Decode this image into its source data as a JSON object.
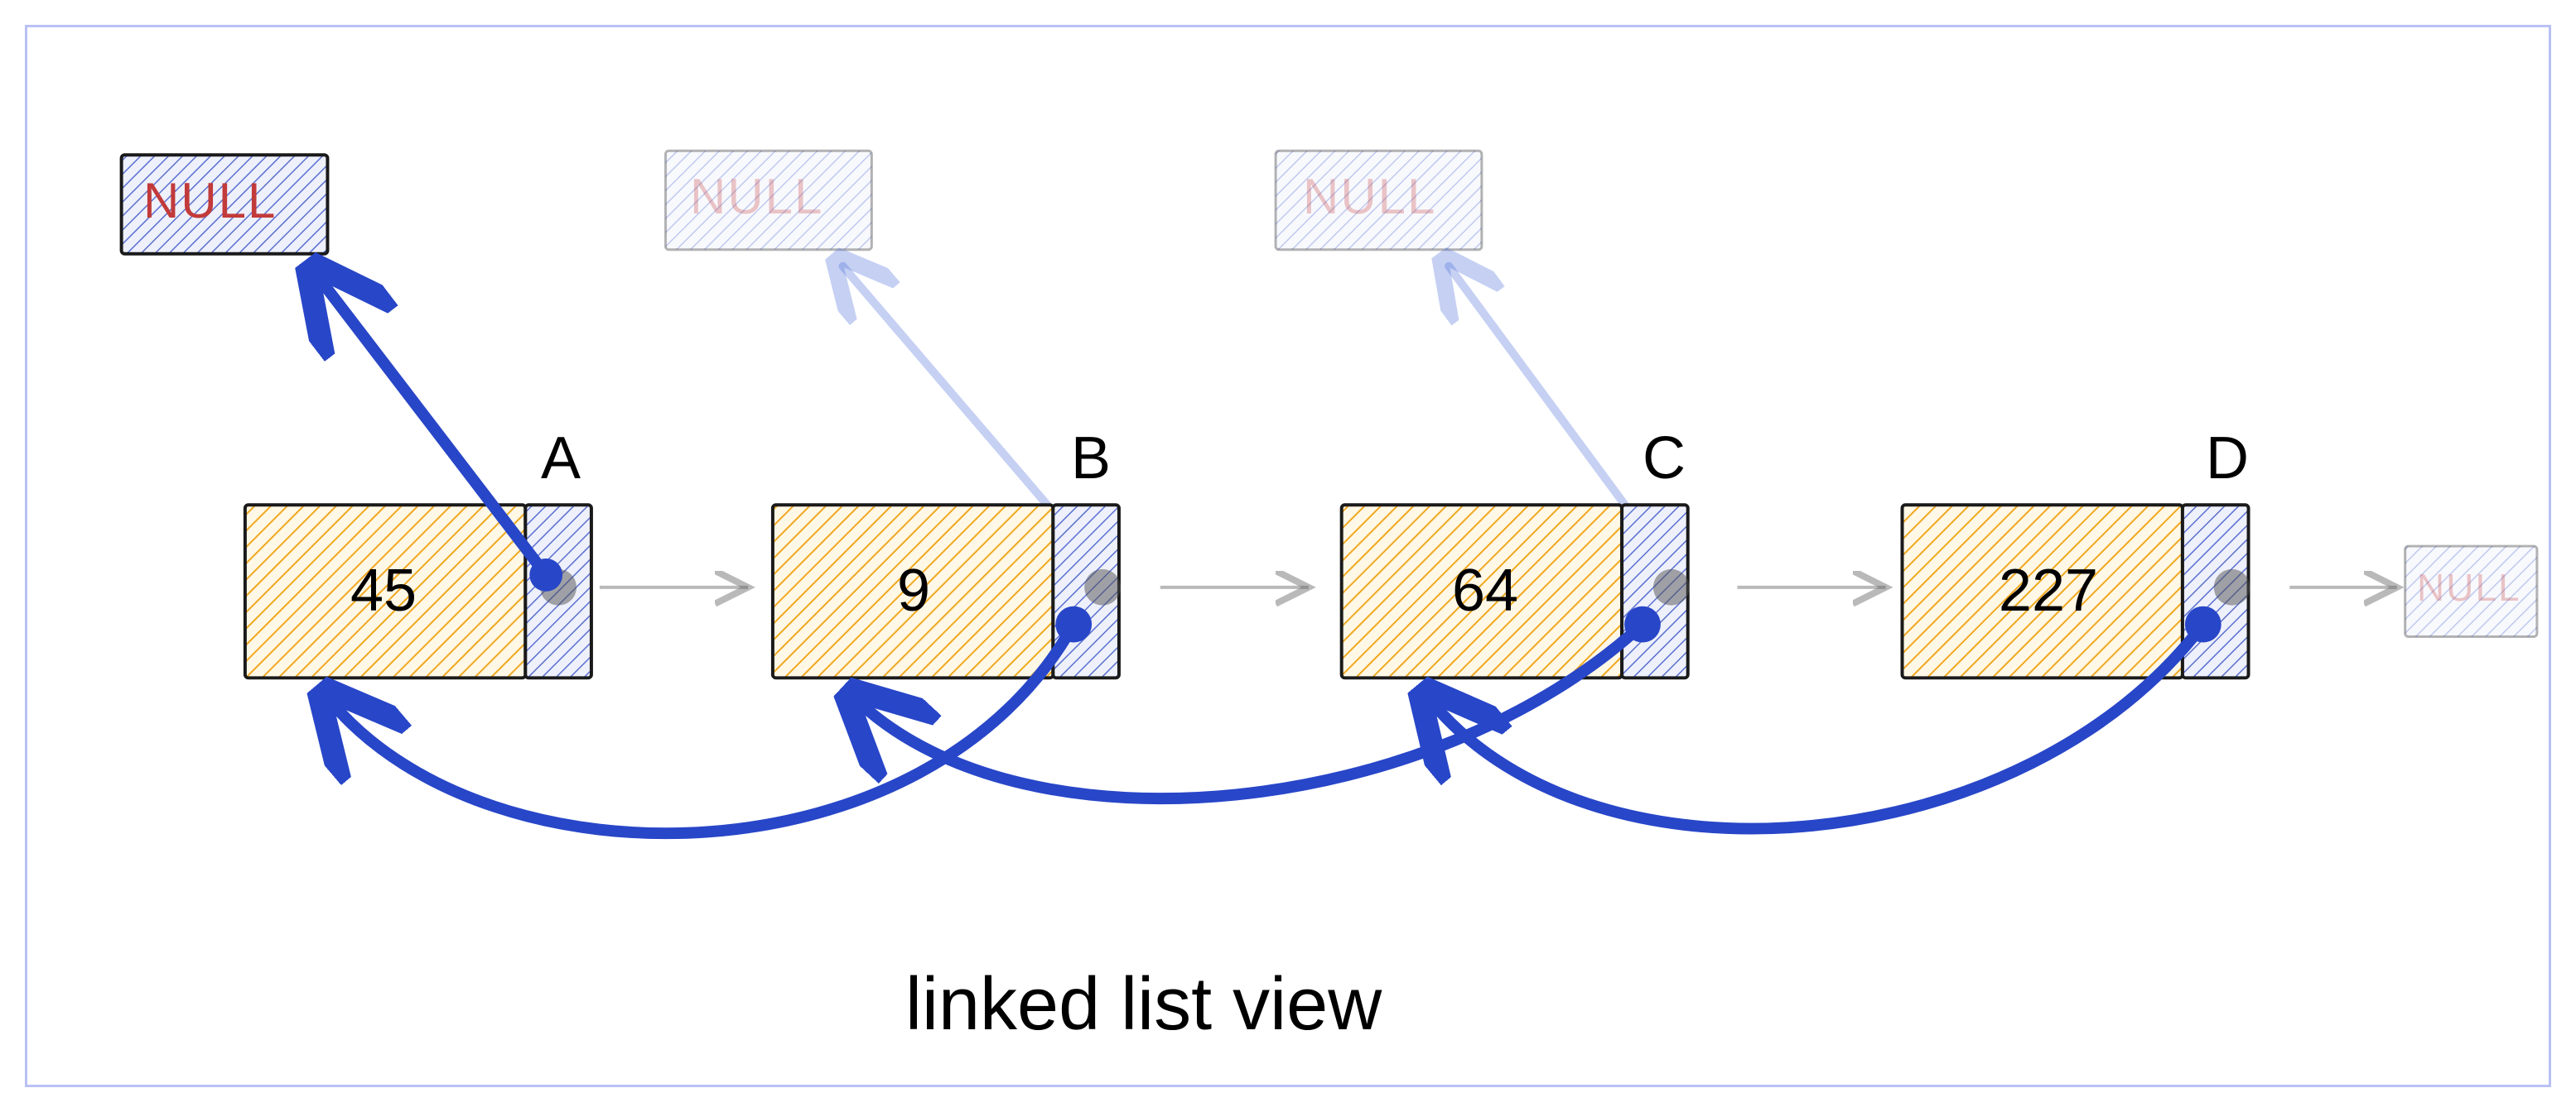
{
  "caption": "linked list view",
  "null_label": "NULL",
  "nodes": [
    {
      "id": "A",
      "value": "45"
    },
    {
      "id": "B",
      "value": "9"
    },
    {
      "id": "C",
      "value": "64"
    },
    {
      "id": "D",
      "value": "227"
    }
  ],
  "original_forward_links": [
    {
      "from": "A",
      "to": "B"
    },
    {
      "from": "B",
      "to": "C"
    },
    {
      "from": "C",
      "to": "D"
    },
    {
      "from": "D",
      "to": "NULL"
    }
  ],
  "reversed_links": [
    {
      "from": "A",
      "to": "NULL",
      "active": true
    },
    {
      "from": "B",
      "to": "A",
      "active": true
    },
    {
      "from": "B",
      "to": "NULL",
      "active": false
    },
    {
      "from": "C",
      "to": "B",
      "active": true
    },
    {
      "from": "C",
      "to": "NULL",
      "active": false
    },
    {
      "from": "D",
      "to": "C",
      "active": true
    }
  ],
  "top_null_boxes": [
    {
      "over_node": "A",
      "faded": false
    },
    {
      "over_node": "B",
      "faded": true
    },
    {
      "over_node": "C",
      "faded": true
    }
  ],
  "trailing_null_faded": true
}
